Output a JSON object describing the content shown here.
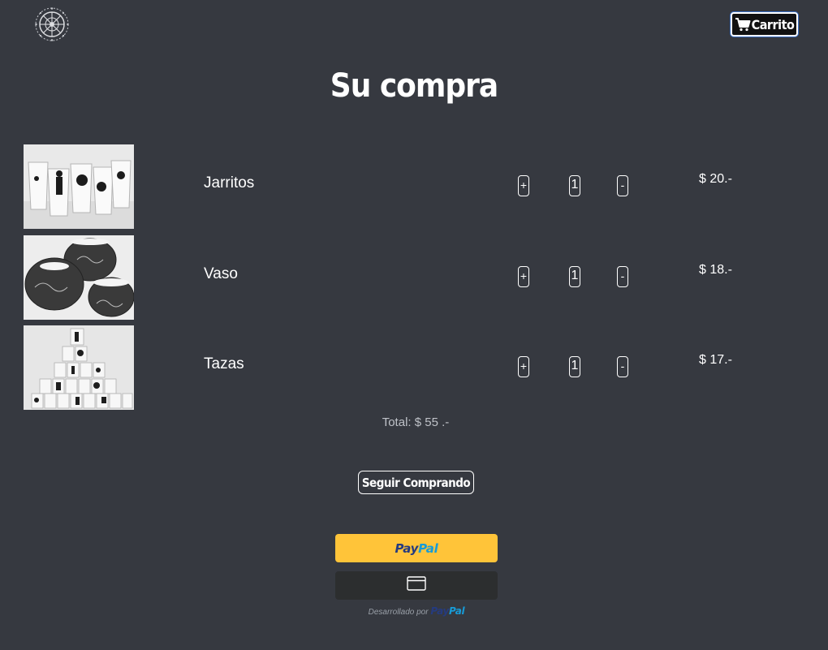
{
  "header": {
    "logo_icon": "mandala-logo-icon",
    "cart_button": {
      "label": "Carrito",
      "icon": "cart-icon"
    }
  },
  "title": "Su compra",
  "items": [
    {
      "name": "Jarritos",
      "quantity": "1",
      "plus_label": "+",
      "minus_label": "-",
      "price": "$ 20.-",
      "image": "mugs-photo"
    },
    {
      "name": "Vaso",
      "quantity": "1",
      "plus_label": "+",
      "minus_label": "-",
      "price": "$ 18.-",
      "image": "cups-photo"
    },
    {
      "name": "Tazas",
      "quantity": "1",
      "plus_label": "+",
      "minus_label": "-",
      "price": "$ 17.-",
      "image": "stacked-mugs-photo"
    }
  ],
  "total": "Total: $ 55 .-",
  "continue_button": "Seguir Comprando",
  "paypal": {
    "brand_dark": "Pay",
    "brand_light": "Pal",
    "card_icon": "credit-card-icon",
    "powered_by": "Desarrollado por",
    "colors": {
      "button_bg": "#ffc439",
      "card_bg": "#2c2e2f",
      "brand_dark": "#253b80",
      "brand_light": "#179bd7"
    }
  },
  "colors": {
    "page_bg": "#363940",
    "text": "#ffffff",
    "muted_text": "#bfc2c8"
  }
}
